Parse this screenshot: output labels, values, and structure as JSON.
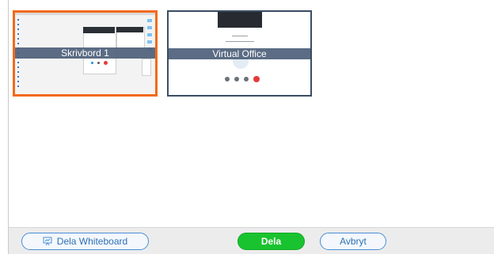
{
  "screens": [
    {
      "label": "Skrivbord 1",
      "selected": true
    },
    {
      "label": "Virtual Office",
      "selected": false
    }
  ],
  "footer": {
    "whiteboard_label": "Dela Whiteboard",
    "whiteboard_icon": "whiteboard-icon",
    "share_label": "Dela",
    "cancel_label": "Avbryt"
  },
  "colors": {
    "selection": "#f26a1b",
    "share_button": "#19c32f",
    "outline_button": "#4a8fd6"
  }
}
